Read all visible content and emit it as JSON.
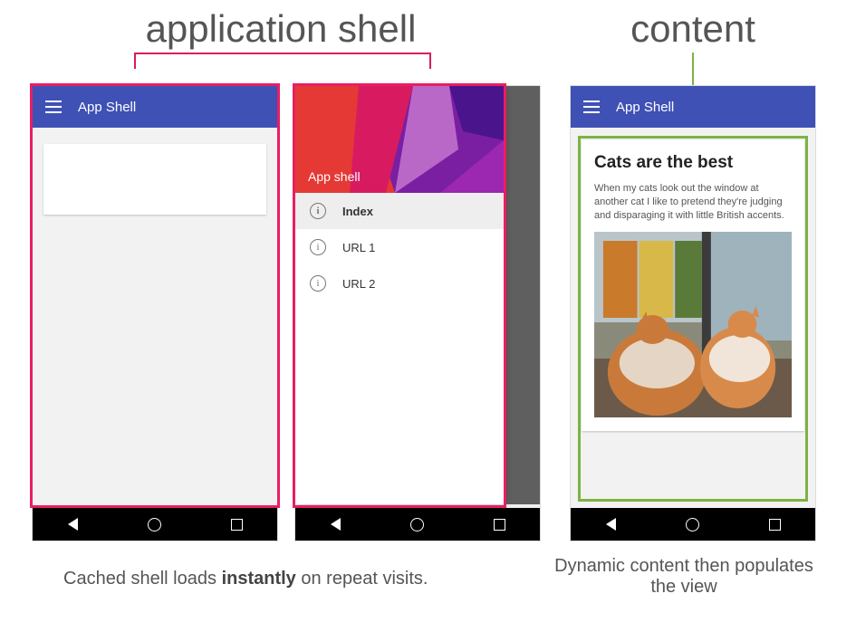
{
  "headings": {
    "shell": "application shell",
    "content": "content"
  },
  "appbar": {
    "title": "App Shell"
  },
  "drawer": {
    "hero_label": "App shell",
    "items": [
      {
        "label": "Index",
        "active": true
      },
      {
        "label": "URL 1",
        "active": false
      },
      {
        "label": "URL 2",
        "active": false
      }
    ]
  },
  "article": {
    "title": "Cats are the best",
    "body": "When my cats look out the window at another cat I like to pretend they're judging and disparaging it with little British accents."
  },
  "captions": {
    "left_pre": "Cached shell loads ",
    "left_strong": "instantly",
    "left_post": " on repeat visits.",
    "right": "Dynamic content then populates the view"
  },
  "icons": {
    "menu": "menu-icon",
    "info": "info-icon",
    "back": "back-icon",
    "home": "home-icon",
    "recent": "recent-icon"
  }
}
